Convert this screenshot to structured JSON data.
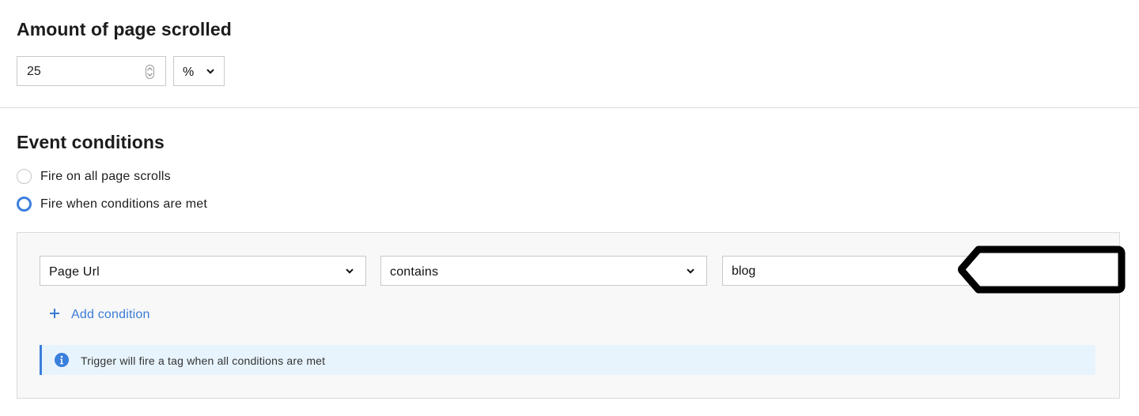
{
  "scroll_section": {
    "title": "Amount of page scrolled",
    "amount_value": "25",
    "unit_value": "%"
  },
  "conditions_section": {
    "title": "Event conditions",
    "radio_options": [
      {
        "label": "Fire on all page scrolls",
        "selected": false
      },
      {
        "label": "Fire when conditions are met",
        "selected": true
      }
    ],
    "condition": {
      "field_value": "Page Url",
      "operator_value": "contains",
      "match_value": "blog"
    },
    "add_condition_label": "Add condition",
    "info_message": "Trigger will fire a tag when all conditions are met"
  },
  "icons": {
    "spinner": "number-spinner-icon",
    "chevron": "chevron-down-icon",
    "plus": "plus-icon",
    "info": "info-icon",
    "annotation": "arrow-annotation"
  },
  "colors": {
    "accent": "#3b7fdc",
    "link": "#3a7bd5",
    "info_background": "#e8f4fd",
    "panel_background": "#f8f8f8"
  }
}
